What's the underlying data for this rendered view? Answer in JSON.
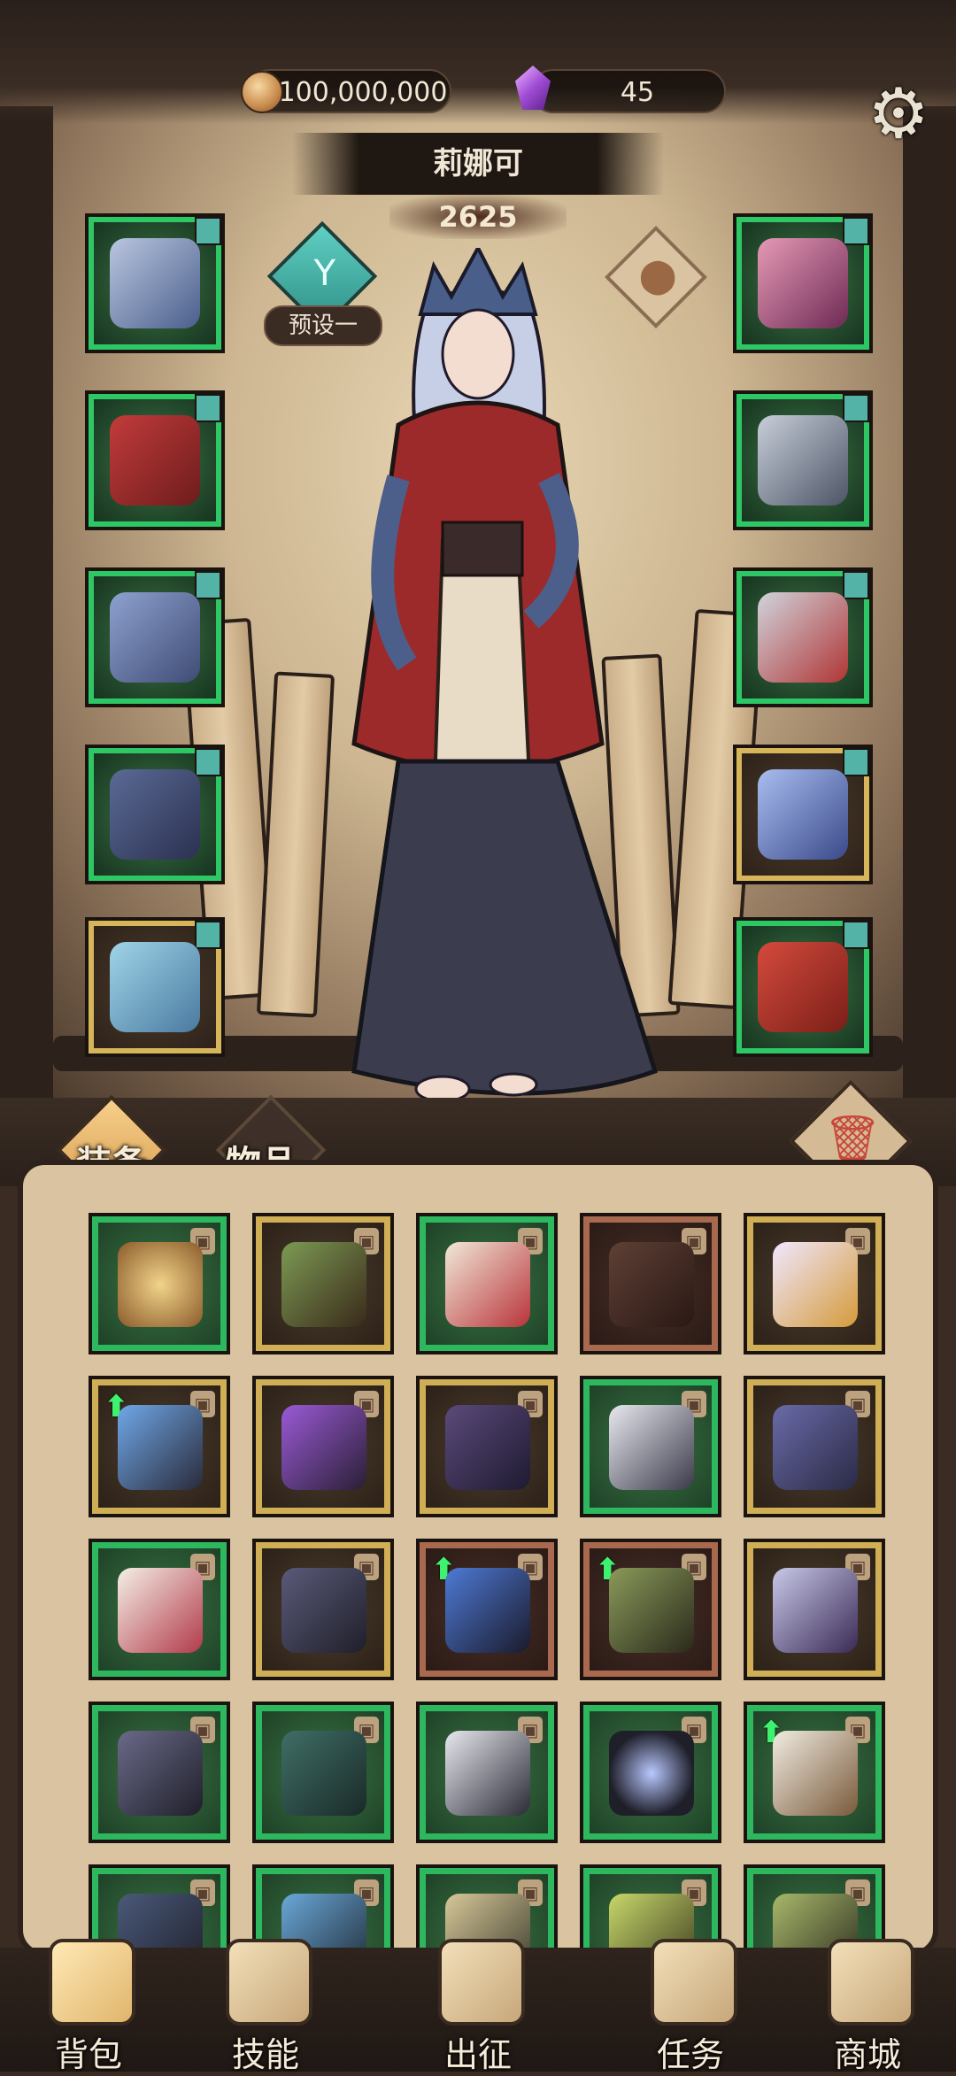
{
  "resources": {
    "gold_amount": "100,000,000",
    "gem_amount": "45"
  },
  "hero": {
    "name": "莉娜可",
    "power": "2625",
    "preset_label": "预设一"
  },
  "tabs": {
    "equipment": "装备",
    "items": "物品"
  },
  "nav": {
    "bag": "背包",
    "skills": "技能",
    "expedition": "出征",
    "quests": "任务",
    "shop": "商城"
  },
  "colors": {
    "rarity_green": "#2db860",
    "rarity_gold": "#cfae55",
    "rarity_red": "#a8694f",
    "upgrade_arrow": "#3ef26f"
  },
  "icons": {
    "settings": "gear-icon",
    "gold": "coin-icon",
    "gem": "purple-gem-icon",
    "delete": "trash-icon",
    "lock": "lock-icon",
    "upgrade": "up-arrow-icon"
  }
}
